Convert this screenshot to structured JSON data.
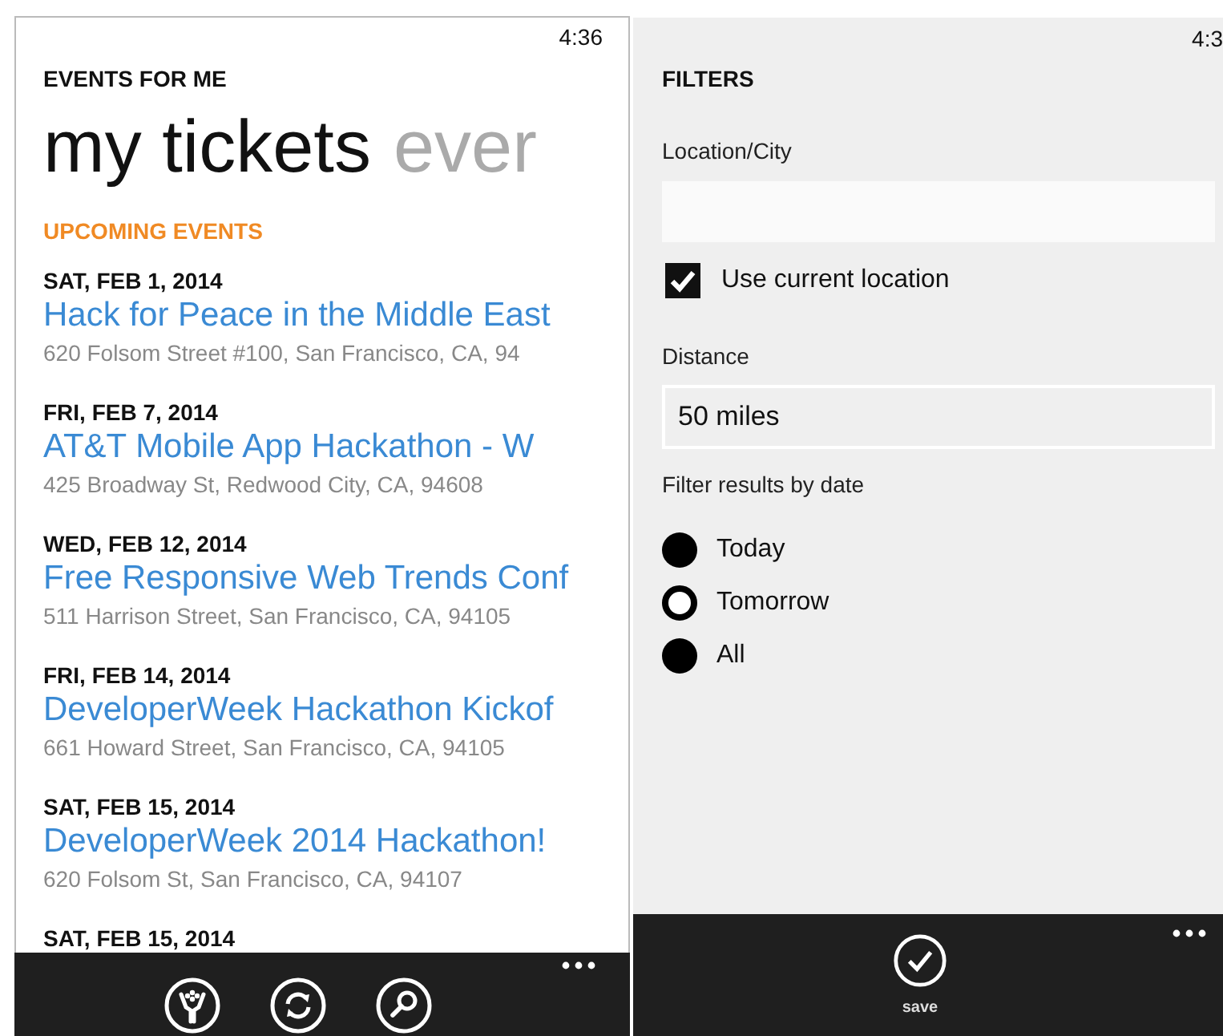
{
  "left_screen": {
    "status_time": "4:36",
    "app_title": "EVENTS FOR ME",
    "pivot_headers": [
      {
        "label": "my tickets",
        "selected": true
      },
      {
        "label": "ever",
        "selected": false
      }
    ],
    "section_heading": "UPCOMING EVENTS",
    "events": [
      {
        "date": "SAT, FEB 1, 2014",
        "title": "Hack for Peace in the Middle East",
        "address": "620 Folsom Street #100, San Francisco, CA, 94"
      },
      {
        "date": "FRI, FEB 7, 2014",
        "title": "AT&T Mobile App Hackathon - W",
        "address": "425 Broadway St, Redwood City, CA, 94608"
      },
      {
        "date": "WED, FEB 12, 2014",
        "title": "Free Responsive Web Trends Conf",
        "address": "511 Harrison Street, San Francisco, CA, 94105"
      },
      {
        "date": "FRI, FEB 14, 2014",
        "title": "DeveloperWeek Hackathon Kickof",
        "address": "661 Howard Street, San Francisco, CA, 94105"
      },
      {
        "date": "SAT, FEB 15, 2014",
        "title": "DeveloperWeek 2014 Hackathon!",
        "address": "620 Folsom St, San Francisco, CA, 94107"
      },
      {
        "date": "SAT, FEB 15, 2014"
      }
    ]
  },
  "right_screen": {
    "status_time": "4:3",
    "title": "FILTERS",
    "location_label": "Location/City",
    "use_current_location": {
      "label": "Use current location",
      "checked": true
    },
    "distance_label": "Distance",
    "distance_field": {
      "value": "50 miles"
    },
    "date_filter_label": "Filter results by date",
    "date_options": [
      {
        "label": "Today",
        "selected": false
      },
      {
        "label": "Tomorrow",
        "selected": true
      },
      {
        "label": "All",
        "selected": false
      }
    ],
    "save_button": {
      "label": "save"
    }
  }
}
